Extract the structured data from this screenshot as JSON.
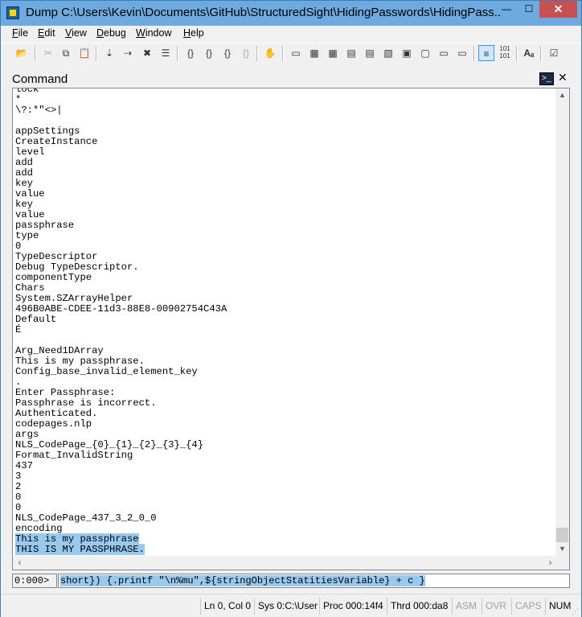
{
  "window": {
    "title": "Dump C:\\Users\\Kevin\\Documents\\GitHub\\StructuredSight\\HidingPasswords\\HidingPass...",
    "controls": {
      "minimize": "—",
      "maximize": "☐",
      "close": "✕"
    }
  },
  "menu": [
    {
      "u": "F",
      "rest": "ile"
    },
    {
      "u": "E",
      "rest": "dit"
    },
    {
      "u": "V",
      "rest": "iew"
    },
    {
      "u": "D",
      "rest": "ebug"
    },
    {
      "u": "W",
      "rest": "indow"
    },
    {
      "u": "H",
      "rest": "elp"
    }
  ],
  "toolbar_icons": [
    "open-icon",
    "cut-icon",
    "copy-icon",
    "paste-icon",
    "step-into-icon",
    "step-over-icon",
    "remove-breakpoint-icon",
    "breakpoints-icon",
    "brace-icon",
    "brace-in-icon",
    "brace-out-icon",
    "brace-disabled-icon",
    "hand-icon",
    "command-window-icon",
    "watch-icon",
    "locals-icon",
    "registers-icon",
    "memory-icon",
    "call-stack-icon",
    "disassembly-icon",
    "scratch-pad-icon",
    "processes-icon",
    "source-mode-icon",
    "binary-icon",
    "font-icon",
    "options-icon"
  ],
  "pane": {
    "title": "Command",
    "close": "✕",
    "icon": ">_"
  },
  "output_lines": [
    "lock",
    "*",
    "\\?:*\"<>|",
    "",
    "appSettings",
    "CreateInstance",
    "level",
    "add",
    "add",
    "key",
    "value",
    "key",
    "value",
    "passphrase",
    "type",
    "0",
    "TypeDescriptor",
    "Debug TypeDescriptor.",
    "componentType",
    "Chars",
    "System.SZArrayHelper",
    "496B0ABE-CDEE-11d3-88E8-00902754C43A",
    "Default",
    "É",
    "",
    "Arg_Need1DArray",
    "This is my passphrase.",
    "Config_base_invalid_element_key",
    ".",
    "Enter Passphrase:",
    "Passphrase is incorrect.",
    "Authenticated.",
    "codepages.nlp",
    "args",
    "NLS_CodePage_{0}_{1}_{2}_{3}_{4}",
    "Format_InvalidString",
    "437",
    "3",
    "2",
    "0",
    "0",
    "NLS_CodePage_437_3_2_0_0",
    "encoding",
    "This is my passphrase",
    "THIS IS MY PASSPHRASE."
  ],
  "selected_lines": [
    43,
    44
  ],
  "scroll": {
    "up": "▲",
    "down": "▼",
    "left": "‹",
    "right": "›"
  },
  "command": {
    "prompt": "0:000>",
    "value": "short}) {.printf \"\\n%mu\",${stringObjectStatitiesVariable} + c }"
  },
  "status": {
    "position": "Ln 0, Col 0",
    "sys": "Sys 0:C:\\User",
    "proc": "Proc 000:14f4",
    "thrd": "Thrd 000:da8",
    "asm": "ASM",
    "ovr": "OVR",
    "caps": "CAPS",
    "num": "NUM"
  }
}
